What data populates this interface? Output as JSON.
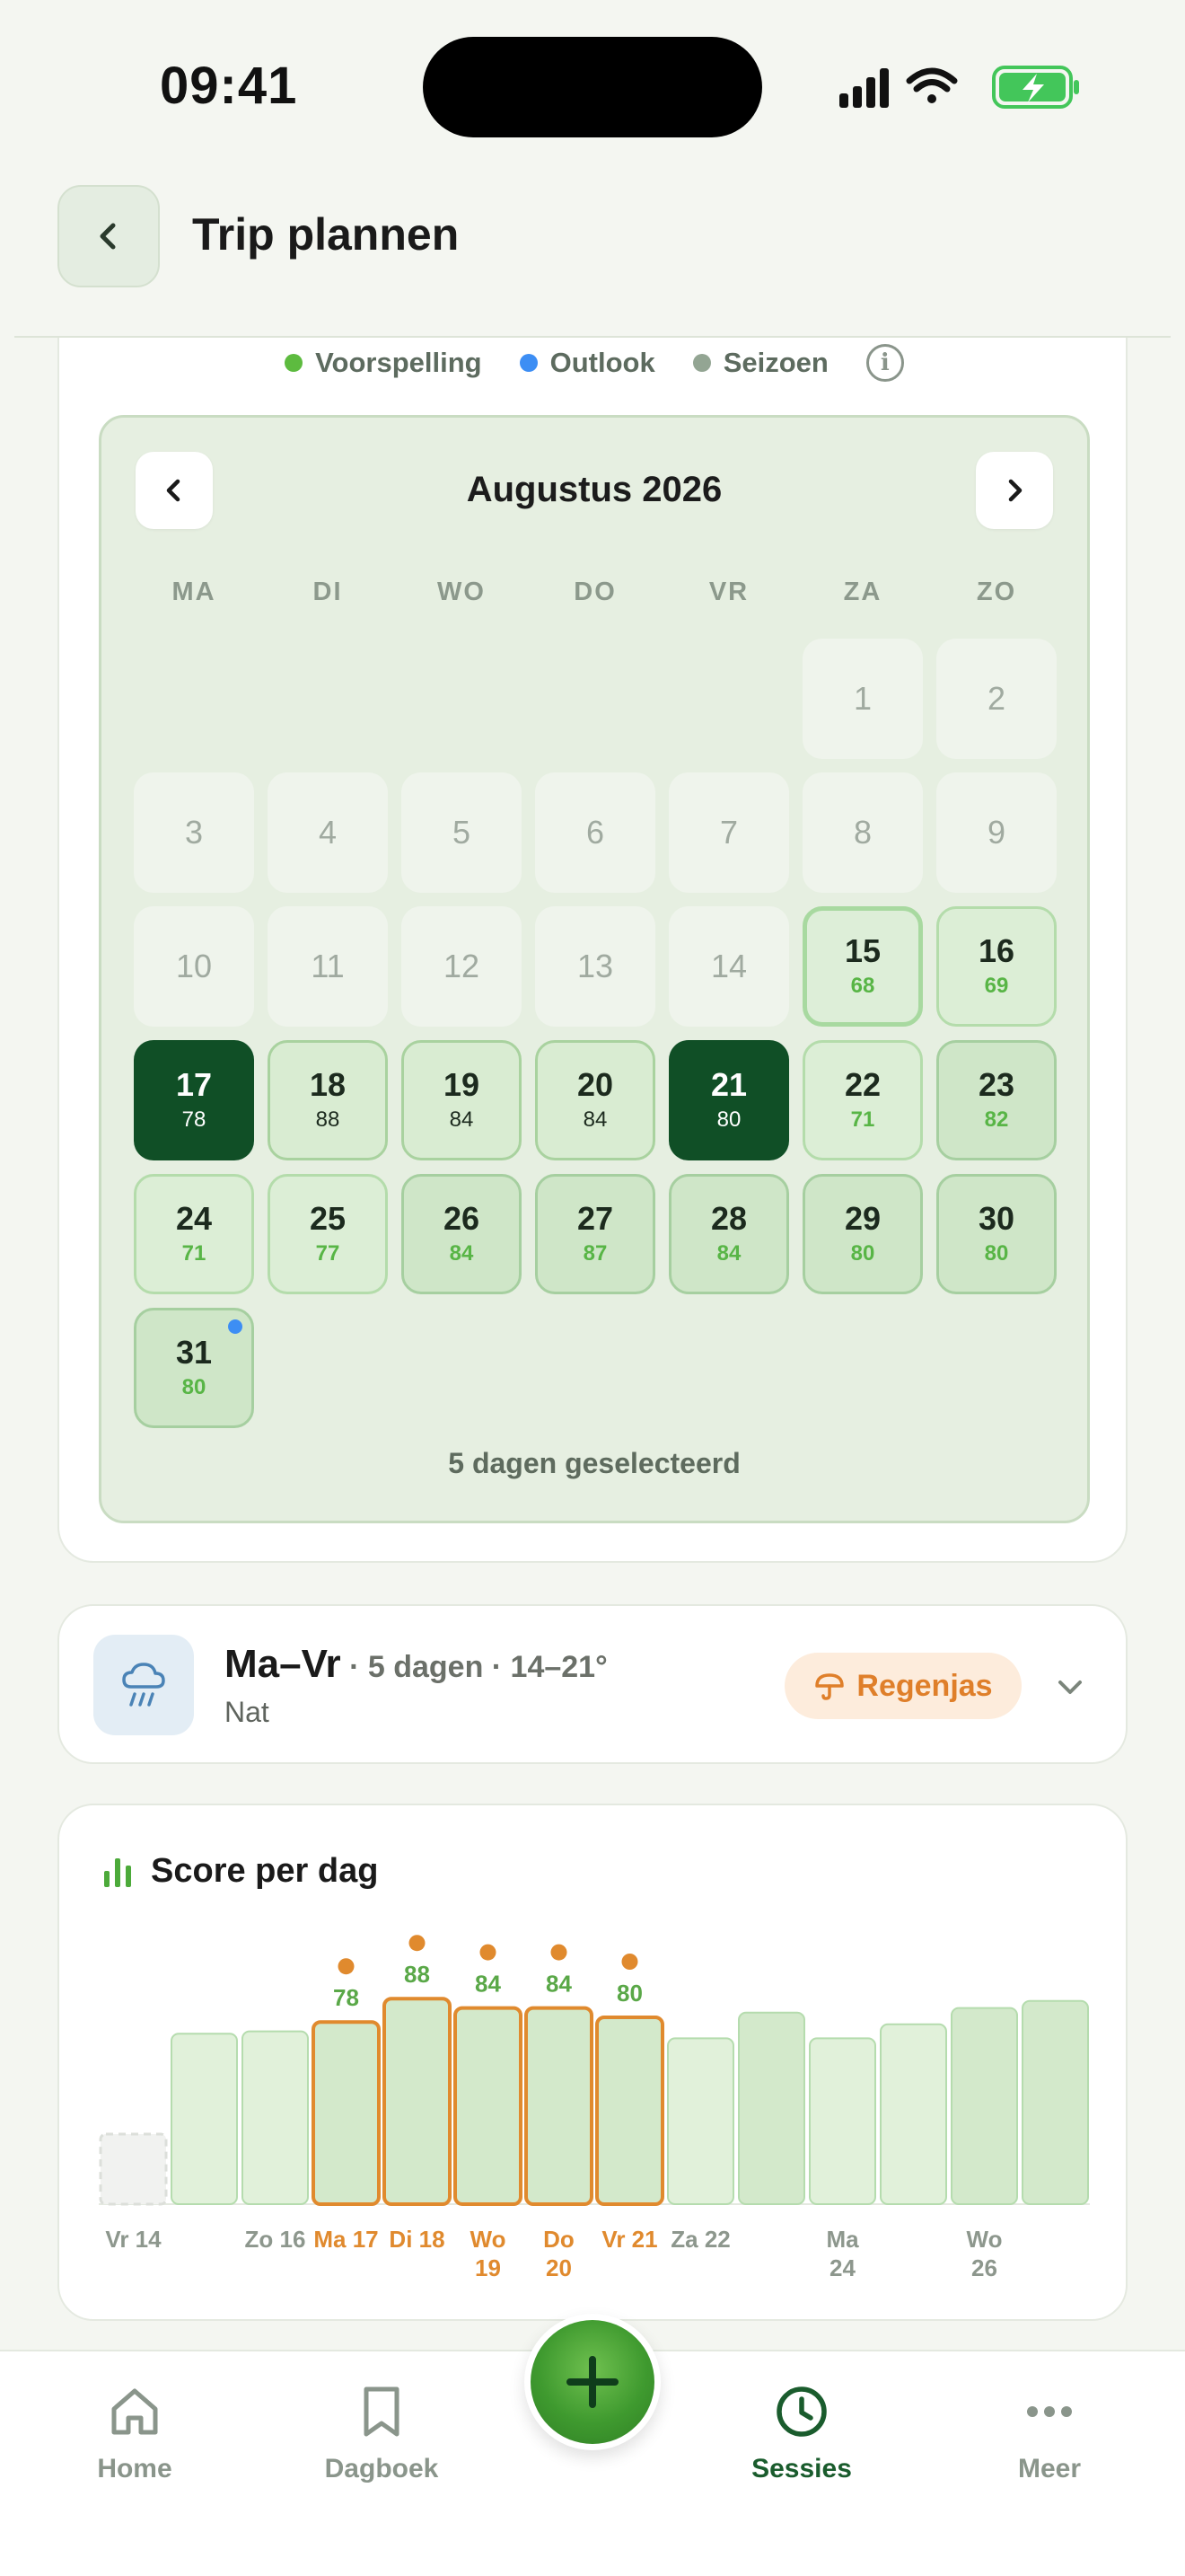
{
  "status_bar": {
    "time": "09:41"
  },
  "header": {
    "title": "Trip plannen"
  },
  "legend": [
    {
      "label": "Voorspelling",
      "color": "#5dbb3f"
    },
    {
      "label": "Outlook",
      "color": "#3d8ef4"
    },
    {
      "label": "Seizoen",
      "color": "#93a593"
    }
  ],
  "calendar": {
    "month_label": "Augustus 2026",
    "weekdays": [
      "MA",
      "DI",
      "WO",
      "DO",
      "VR",
      "ZA",
      "ZO"
    ],
    "days": [
      {
        "day": "1",
        "state": "past"
      },
      {
        "day": "2",
        "state": "past"
      },
      {
        "day": "3",
        "state": "past"
      },
      {
        "day": "4",
        "state": "past"
      },
      {
        "day": "5",
        "state": "past"
      },
      {
        "day": "6",
        "state": "past"
      },
      {
        "day": "7",
        "state": "past"
      },
      {
        "day": "8",
        "state": "past"
      },
      {
        "day": "9",
        "state": "past"
      },
      {
        "day": "10",
        "state": "past"
      },
      {
        "day": "11",
        "state": "past"
      },
      {
        "day": "12",
        "state": "past"
      },
      {
        "day": "13",
        "state": "past"
      },
      {
        "day": "14",
        "state": "past"
      },
      {
        "day": "15",
        "score": "68",
        "state": "today"
      },
      {
        "day": "16",
        "score": "69",
        "state": "season"
      },
      {
        "day": "17",
        "score": "78",
        "state": "selected"
      },
      {
        "day": "18",
        "score": "88",
        "state": "forecast"
      },
      {
        "day": "19",
        "score": "84",
        "state": "forecast"
      },
      {
        "day": "20",
        "score": "84",
        "state": "forecast"
      },
      {
        "day": "21",
        "score": "80",
        "state": "selected"
      },
      {
        "day": "22",
        "score": "71",
        "state": "season"
      },
      {
        "day": "23",
        "score": "82",
        "state": "season-strong"
      },
      {
        "day": "24",
        "score": "71",
        "state": "season"
      },
      {
        "day": "25",
        "score": "77",
        "state": "season"
      },
      {
        "day": "26",
        "score": "84",
        "state": "season-strong"
      },
      {
        "day": "27",
        "score": "87",
        "state": "season-strong"
      },
      {
        "day": "28",
        "score": "84",
        "state": "season-strong"
      },
      {
        "day": "29",
        "score": "80",
        "state": "season-strong"
      },
      {
        "day": "30",
        "score": "80",
        "state": "season-strong"
      },
      {
        "day": "31",
        "score": "80",
        "state": "season-strong",
        "outlook": true
      }
    ],
    "selection_summary": "5 dagen geselecteerd"
  },
  "weather_summary": {
    "range": "Ma–Vr",
    "meta": " · 5 dagen · 14–21°",
    "description": "Nat",
    "badge_label": "Regenjas",
    "icon": "rain-cloud-icon"
  },
  "score_chart": {
    "title": "Score per dag",
    "bars": [
      {
        "label": "Vr 14",
        "value": 0,
        "empty": true
      },
      {
        "label": "",
        "value": 73
      },
      {
        "label": "Zo 16",
        "value": 74
      },
      {
        "label": "Ma 17",
        "value": 78,
        "selected": true
      },
      {
        "label": "Di 18",
        "value": 88,
        "selected": true
      },
      {
        "label": "Wo 19",
        "value": 84,
        "selected": true
      },
      {
        "label": "Do 20",
        "value": 84,
        "selected": true
      },
      {
        "label": "Vr 21",
        "value": 80,
        "selected": true
      },
      {
        "label": "Za 22",
        "value": 71
      },
      {
        "label": "",
        "value": 82,
        "strong": true
      },
      {
        "label": "Ma 24",
        "value": 71
      },
      {
        "label": "",
        "value": 77
      },
      {
        "label": "Wo 26",
        "value": 84,
        "strong": true
      },
      {
        "label": "",
        "value": 87,
        "strong": true
      }
    ],
    "colors": {
      "selected": "#e08a2e",
      "label": "#5aa848",
      "bar_light": "#e1f1da",
      "bar_strong": "#d3e9cb"
    }
  },
  "bottom_nav": [
    {
      "label": "Home",
      "icon": "home-icon",
      "active": false
    },
    {
      "label": "Dagboek",
      "icon": "bookmark-icon",
      "active": false
    },
    {
      "label": "Sessies",
      "icon": "clock-icon",
      "active": true
    },
    {
      "label": "Meer",
      "icon": "more-icon",
      "active": false
    }
  ],
  "fab": {
    "icon": "plus-icon"
  }
}
